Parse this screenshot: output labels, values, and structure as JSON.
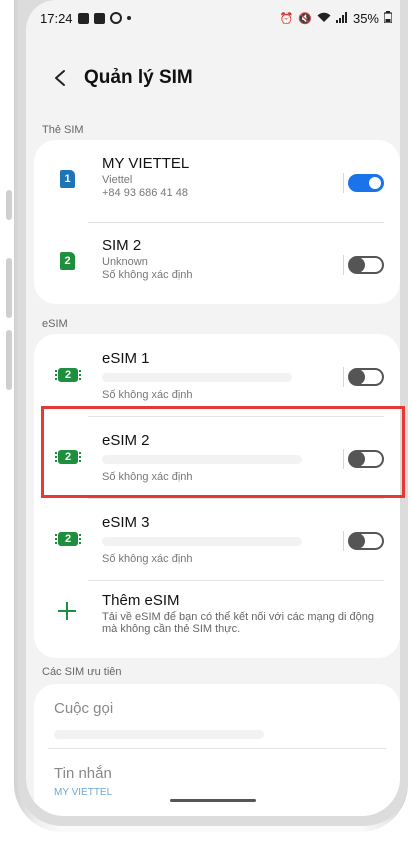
{
  "status_bar": {
    "time": "17:24",
    "battery": "35%"
  },
  "header": {
    "title": "Quản lý SIM",
    "back_icon": "back-arrow-icon"
  },
  "sim_section": {
    "label": "Thẻ SIM",
    "items": [
      {
        "name": "MY VIETTEL",
        "carrier": "Viettel",
        "number": "+84 93 686 41 48",
        "slot": "1",
        "toggle_on": true
      },
      {
        "name": "SIM 2",
        "carrier": "Unknown",
        "number": "Số không xác định",
        "slot": "2",
        "toggle_on": false
      }
    ]
  },
  "esim_section": {
    "label": "eSIM",
    "items": [
      {
        "name": "eSIM 1",
        "number": "Số không xác định",
        "slot": "2",
        "toggle_on": false
      },
      {
        "name": "eSIM 2",
        "number": "Số không xác định",
        "slot": "2",
        "toggle_on": false
      },
      {
        "name": "eSIM 3",
        "number": "Số không xác định",
        "slot": "2",
        "toggle_on": false
      }
    ],
    "add": {
      "title": "Thêm eSIM",
      "description": "Tải về eSIM để bạn có thể kết nối với các mạng di động mà không cần thẻ SIM thực."
    }
  },
  "preferred_section": {
    "label": "Các SIM ưu tiên",
    "calls": {
      "title": "Cuộc gọi",
      "value": ""
    },
    "messages": {
      "title": "Tin nhắn",
      "value": "MY VIETTEL"
    }
  },
  "colors": {
    "accent": "#1a73e8",
    "sim_blue": "#1d74b7",
    "sim_green": "#1e8f3c",
    "highlight": "#e53935"
  }
}
